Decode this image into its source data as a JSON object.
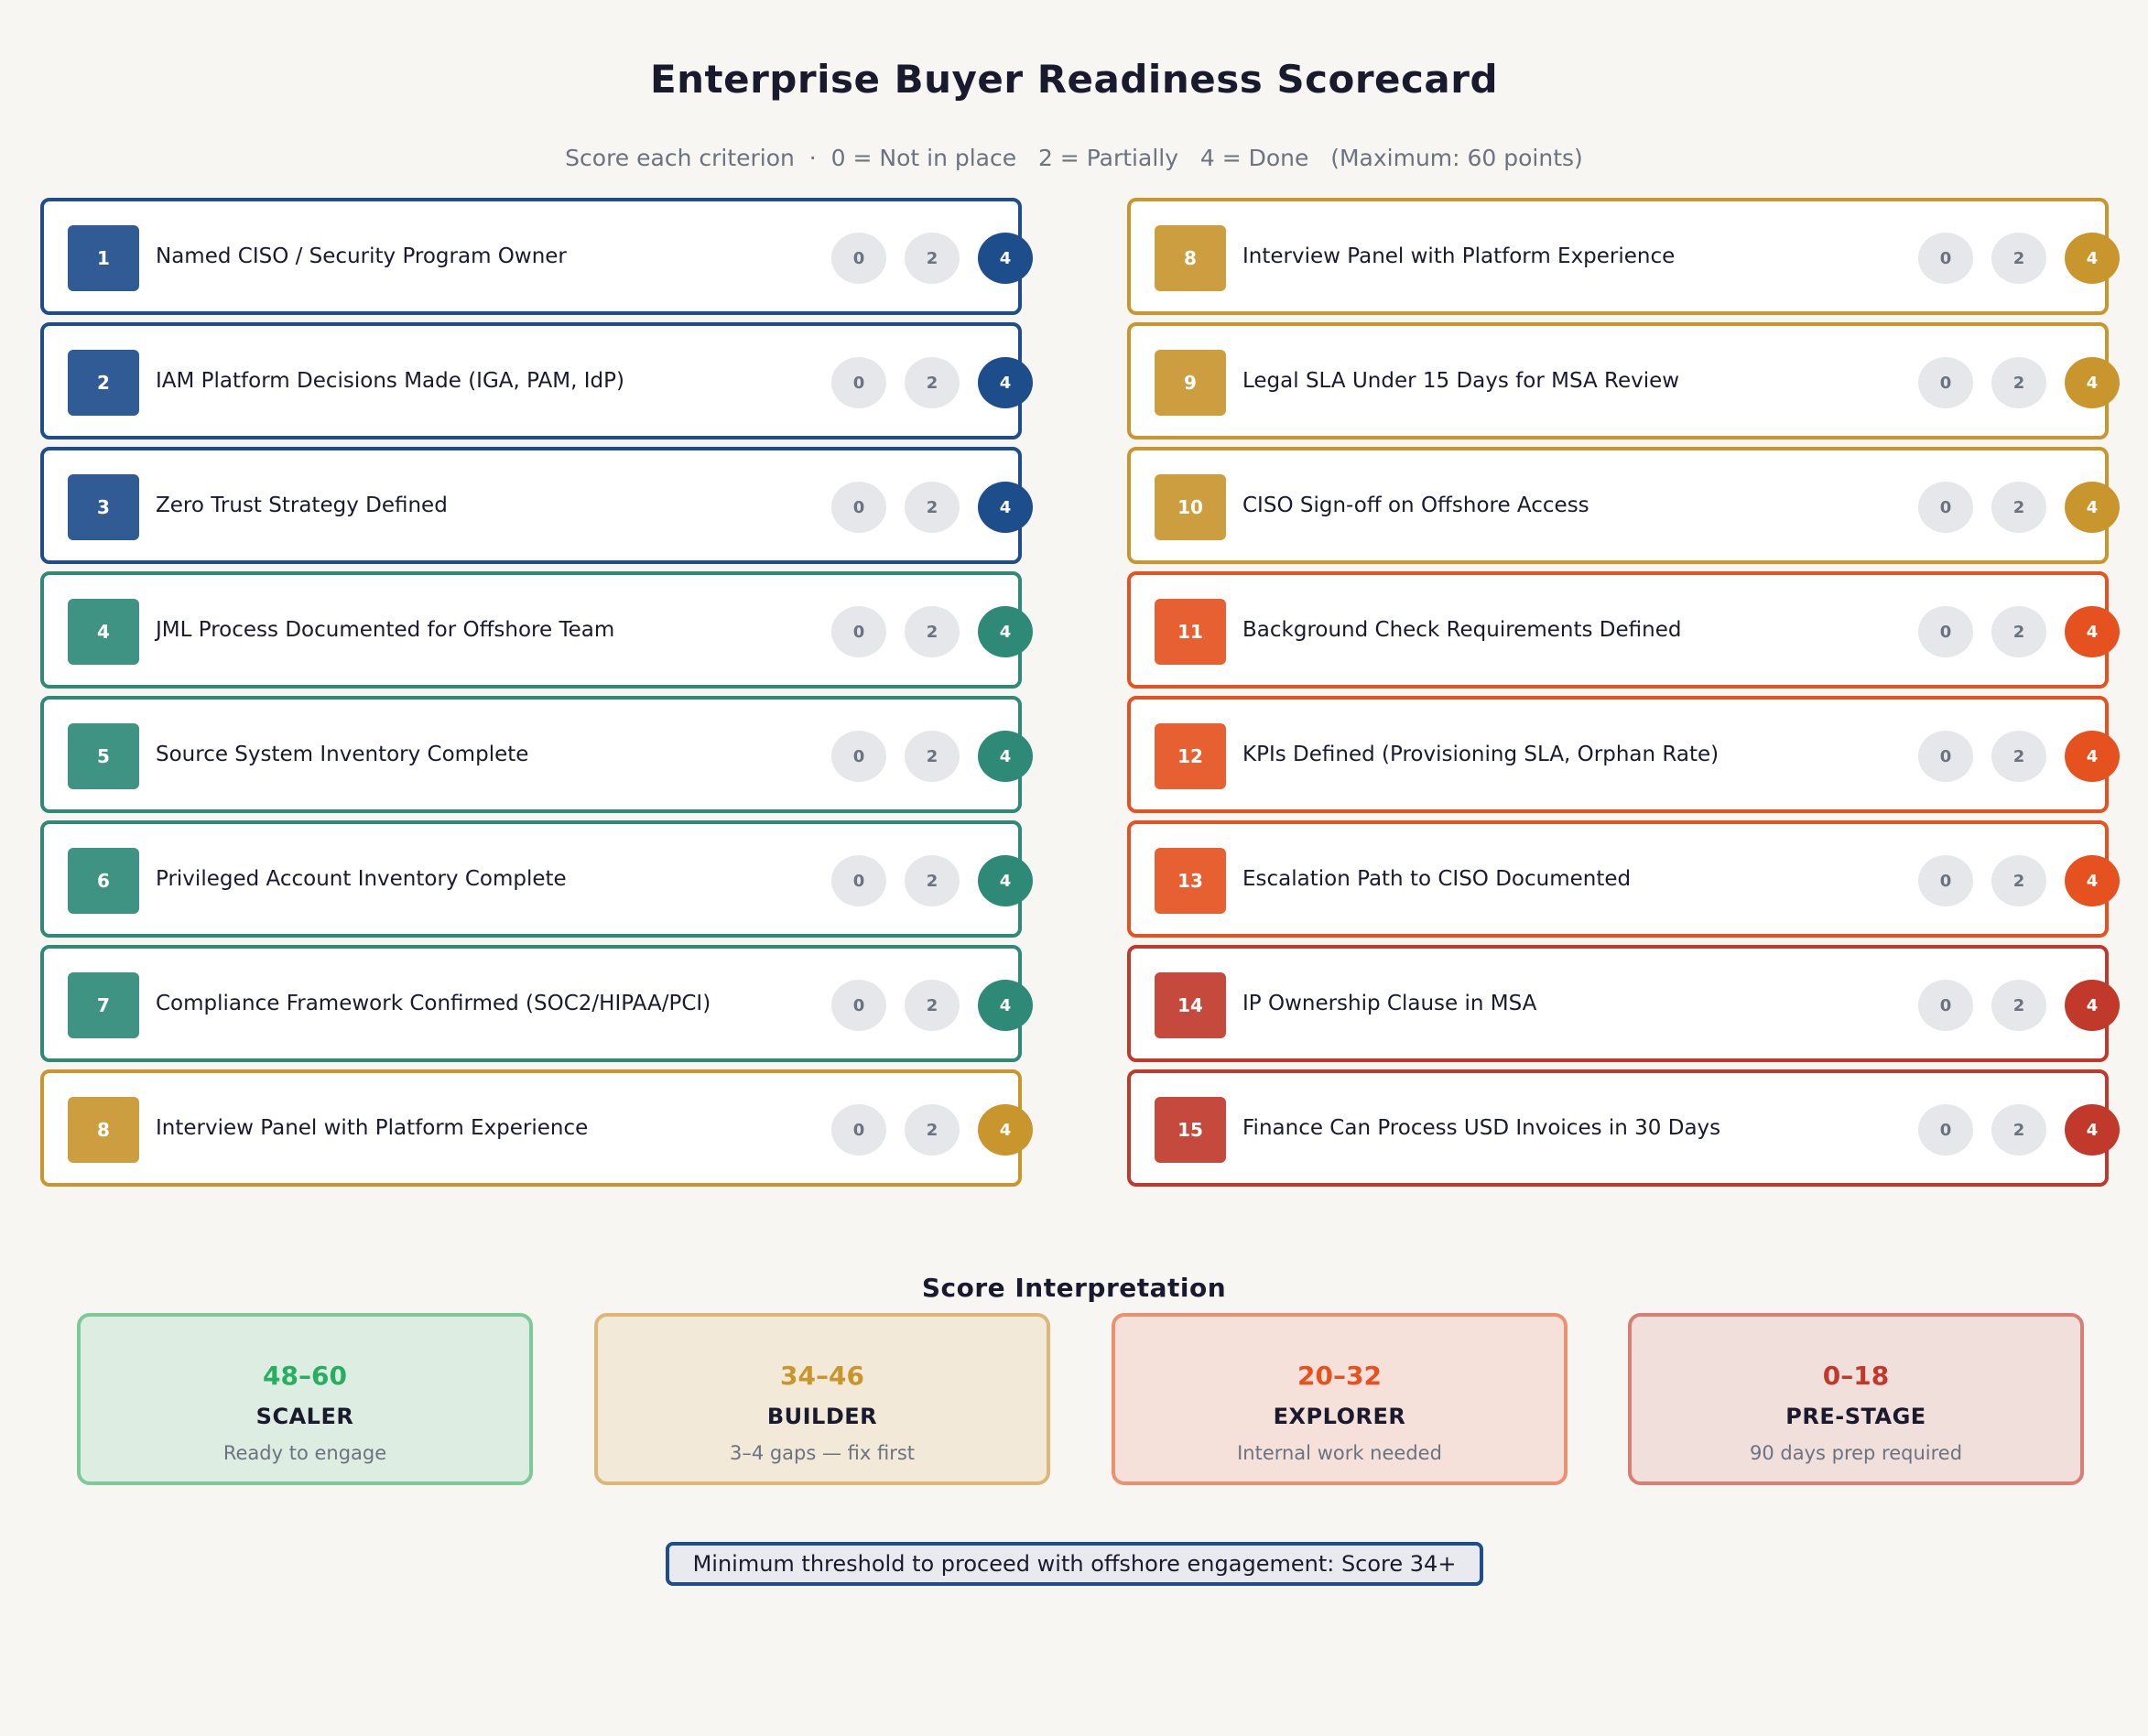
{
  "header": {
    "title": "Enterprise Buyer Readiness Scorecard",
    "subtitle": "Score each criterion  ·  0 = Not in place   2 = Partially   4 = Done   (Maximum: 60 points)"
  },
  "colors": {
    "navy": "#1e4d8c",
    "teal": "#2e8a77",
    "gold": "#c9962e",
    "orange": "#e5521f",
    "red": "#c0392b"
  },
  "score_options": [
    "0",
    "2",
    "4"
  ],
  "criteria_left": [
    {
      "num": "1",
      "label": "Named CISO / Security Program Owner",
      "selected": "4"
    },
    {
      "num": "2",
      "label": "IAM Platform Decisions Made (IGA, PAM, IdP)",
      "selected": "4"
    },
    {
      "num": "3",
      "label": "Zero Trust Strategy Defined",
      "selected": "4"
    },
    {
      "num": "4",
      "label": "JML Process Documented for Offshore Team",
      "selected": "4"
    },
    {
      "num": "5",
      "label": "Source System Inventory Complete",
      "selected": "4"
    },
    {
      "num": "6",
      "label": "Privileged Account Inventory Complete",
      "selected": "4"
    },
    {
      "num": "7",
      "label": "Compliance Framework Confirmed (SOC2/HIPAA/PCI)",
      "selected": "4"
    },
    {
      "num": "8",
      "label": "Interview Panel with Platform Experience",
      "selected": "4"
    }
  ],
  "criteria_right": [
    {
      "num": "8",
      "label": "Interview Panel with Platform Experience",
      "selected": "4"
    },
    {
      "num": "9",
      "label": "Legal SLA Under 15 Days for MSA Review",
      "selected": "4"
    },
    {
      "num": "10",
      "label": "CISO Sign-off on Offshore Access",
      "selected": "4"
    },
    {
      "num": "11",
      "label": "Background Check Requirements Defined",
      "selected": "4"
    },
    {
      "num": "12",
      "label": "KPIs Defined (Provisioning SLA, Orphan Rate)",
      "selected": "4"
    },
    {
      "num": "13",
      "label": "Escalation Path to CISO Documented",
      "selected": "4"
    },
    {
      "num": "14",
      "label": "IP Ownership Clause in MSA",
      "selected": "4"
    },
    {
      "num": "15",
      "label": "Finance Can Process USD Invoices in 30 Days",
      "selected": "4"
    }
  ],
  "interpretation": {
    "title": "Score Interpretation",
    "tiers": [
      {
        "range": "48–60",
        "name": "SCALER",
        "desc": "Ready to engage",
        "color": "#27ae60",
        "bg": "#deede1",
        "border": "#7dc99a"
      },
      {
        "range": "34–46",
        "name": "BUILDER",
        "desc": "3–4 gaps — fix first",
        "color": "#c9962e",
        "bg": "#f2e9d8",
        "border": "#dcb775"
      },
      {
        "range": "20–32",
        "name": "EXPLORER",
        "desc": "Internal work needed",
        "color": "#e5521f",
        "bg": "#f5e1d9",
        "border": "#ec9170"
      },
      {
        "range": "0–18",
        "name": "PRE-STAGE",
        "desc": "90 days prep required",
        "color": "#c0392b",
        "bg": "#f1dfdc",
        "border": "#d77f76"
      }
    ]
  },
  "threshold": "Minimum threshold to proceed with offshore engagement: Score 34+"
}
